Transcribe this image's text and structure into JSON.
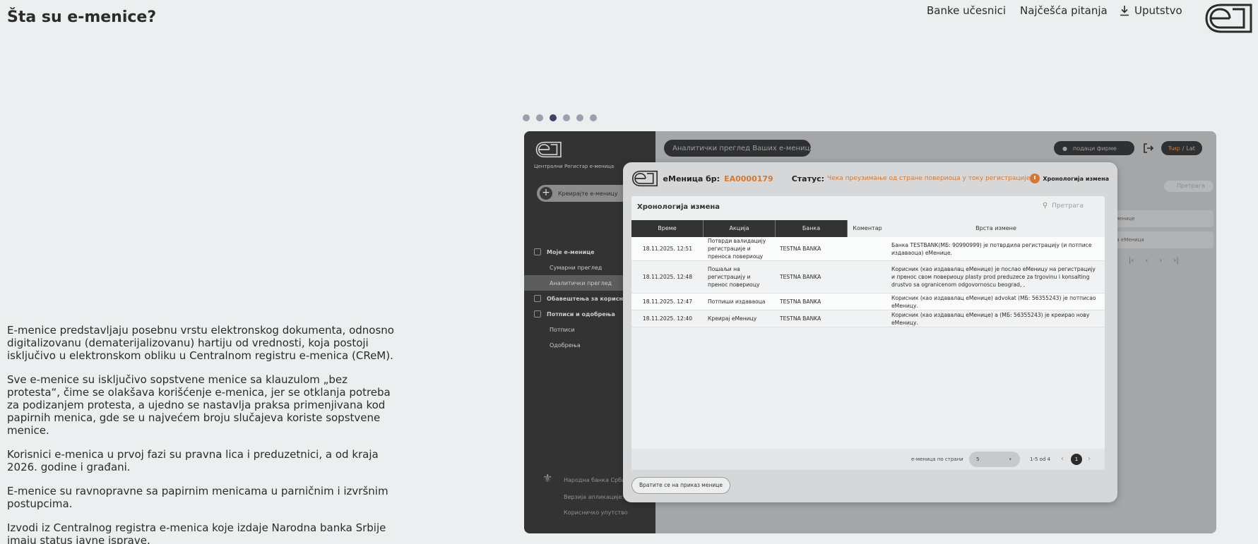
{
  "header": {
    "title": "Šta su e-menice?",
    "nav": [
      {
        "label": "Banke učesnici"
      },
      {
        "label": "Najčešća pitanja"
      },
      {
        "label": "Uputstvo",
        "icon": "download-icon"
      }
    ],
    "logo_icon": "e-menica-logo-icon"
  },
  "intro": {
    "paragraphs": [
      "E-menice predstavljaju posebnu vrstu elektronskog dokumenta, odnosno digitalizovanu (dematerijalizovanu) hartiju od vrednosti, koja postoji isključivo u elektronskom obliku u Centralnom registru e-menica (CReM).",
      "Sve e-menice su isključivo sopstvene menice sa klauzulom „bez protesta“, čime se olakšava korišćenje e-menica, jer se otklanja potreba za podizanjem protesta, a ujedno se nastavlja praksa primenjivana kod papirnih menica, gde se u najvećem broju slučajeva koriste sopstvene menice.",
      "Korisnici e-menica u prvoj fazi su pravna lica i preduzetnici, a od kraja 2026. godine i građani.",
      "E-menice su ravnopravne sa papirnim menicama u parničnim i izvršnim postupcima.",
      "Izvodi iz Centralnog registra e-menica koje izdaje Narodna banka Srbije imaju status javne isprave."
    ]
  },
  "carousel": {
    "dot_count": 6,
    "active_index": 2
  },
  "app": {
    "sidebar": {
      "subtitle": "Централни Регистар е-меница",
      "create_label": "Креирајте е-меницу",
      "items": [
        {
          "label": "Моје е-менице",
          "type": "section"
        },
        {
          "label": "Сумарни преглед",
          "type": "sub"
        },
        {
          "label": "Аналитички преглед",
          "type": "sub"
        },
        {
          "label": "Обавештења за кориснике",
          "type": "section"
        },
        {
          "label": "Потписи и одобрења",
          "type": "section"
        },
        {
          "label": "Потписи",
          "type": "sub"
        },
        {
          "label": "Одобрења",
          "type": "sub"
        }
      ],
      "footer": {
        "bank": "Народна банка Србије",
        "version": "Верзија апликације: 1.0.0",
        "manual": "Корисничко упутство"
      }
    },
    "topbar": {
      "page_label": "Аналитички преглед Ваших е-меница",
      "company": "подаци фирме",
      "lang_active": "Ћир",
      "lang_sep": "/",
      "lang_other": "Lat",
      "search_placeholder": "Претрага",
      "row1": "е-менице",
      "row2": "ука еМеница",
      "pager": "/ 1"
    },
    "modal": {
      "title_label": "еМеница бр:",
      "number": "EA0000179",
      "status_label": "Статус:",
      "status_value": "Чека преузимање од стране повериоца у току регистрације",
      "history_label": "Хронологија измена",
      "card_title": "Хронологија измена",
      "search_placeholder": "Претрага",
      "columns": [
        "Време",
        "Акција",
        "Банка",
        "Коментар",
        "Врста измене"
      ],
      "rows": [
        {
          "time": "18.11.2025. 12:51",
          "action": "Потврди валидацију регистрације и преноса повериоцу",
          "bank": "TESTNA BANKA",
          "comment": "",
          "change": "Банка TESTBANK(МБ: 90990999) је потврдила регистрацију (и потписе издаваоца) еМенице."
        },
        {
          "time": "18.11.2025. 12:48",
          "action": "Пошаљи на регистрацију и пренос повериоцу",
          "bank": "TESTNA BANKA",
          "comment": "",
          "change": "Корисник (као издавалац еМенице) је послао еМеницу на регистрацију и пренос свом повериоцу plasty prod preduzece za trgovinu i konsalting drustvo sa ogranicenom odgovornoscu beograd, ,"
        },
        {
          "time": "18.11.2025. 12:47",
          "action": "Потпиши издаваоца",
          "bank": "TESTNA BANKA",
          "comment": "",
          "change": "Корисник (као издавалац еМенице) advokat (МБ: 56355243) је потписао еМеницу."
        },
        {
          "time": "18.11.2025. 12:40",
          "action": "Креирај еМеницу",
          "bank": "TESTNA BANKA",
          "comment": "",
          "change": "Корисник (као издавалац еМенице) a (МБ: 56355243) је креирао нову еМеницу."
        }
      ],
      "per_page_label": "е-меница по страни",
      "per_page_value": "5",
      "range": "1-5 od 4",
      "prev": "‹",
      "page": "1",
      "next": "›",
      "back_label": "Вратите се на приказ менице"
    }
  },
  "colors": {
    "background": "#ebeff0",
    "accent": "#d8772d",
    "dark": "#333334",
    "dot_active": "#3c4660",
    "dot_inactive": "#9aa1ad"
  }
}
